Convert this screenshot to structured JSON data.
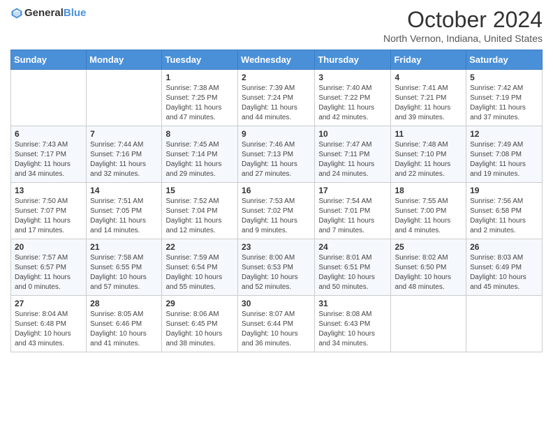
{
  "header": {
    "logo": {
      "text_general": "General",
      "text_blue": "Blue"
    },
    "title": "October 2024",
    "location": "North Vernon, Indiana, United States"
  },
  "days_of_week": [
    "Sunday",
    "Monday",
    "Tuesday",
    "Wednesday",
    "Thursday",
    "Friday",
    "Saturday"
  ],
  "weeks": [
    [
      {
        "day": "",
        "info": ""
      },
      {
        "day": "",
        "info": ""
      },
      {
        "day": "1",
        "info": "Sunrise: 7:38 AM\nSunset: 7:25 PM\nDaylight: 11 hours and 47 minutes."
      },
      {
        "day": "2",
        "info": "Sunrise: 7:39 AM\nSunset: 7:24 PM\nDaylight: 11 hours and 44 minutes."
      },
      {
        "day": "3",
        "info": "Sunrise: 7:40 AM\nSunset: 7:22 PM\nDaylight: 11 hours and 42 minutes."
      },
      {
        "day": "4",
        "info": "Sunrise: 7:41 AM\nSunset: 7:21 PM\nDaylight: 11 hours and 39 minutes."
      },
      {
        "day": "5",
        "info": "Sunrise: 7:42 AM\nSunset: 7:19 PM\nDaylight: 11 hours and 37 minutes."
      }
    ],
    [
      {
        "day": "6",
        "info": "Sunrise: 7:43 AM\nSunset: 7:17 PM\nDaylight: 11 hours and 34 minutes."
      },
      {
        "day": "7",
        "info": "Sunrise: 7:44 AM\nSunset: 7:16 PM\nDaylight: 11 hours and 32 minutes."
      },
      {
        "day": "8",
        "info": "Sunrise: 7:45 AM\nSunset: 7:14 PM\nDaylight: 11 hours and 29 minutes."
      },
      {
        "day": "9",
        "info": "Sunrise: 7:46 AM\nSunset: 7:13 PM\nDaylight: 11 hours and 27 minutes."
      },
      {
        "day": "10",
        "info": "Sunrise: 7:47 AM\nSunset: 7:11 PM\nDaylight: 11 hours and 24 minutes."
      },
      {
        "day": "11",
        "info": "Sunrise: 7:48 AM\nSunset: 7:10 PM\nDaylight: 11 hours and 22 minutes."
      },
      {
        "day": "12",
        "info": "Sunrise: 7:49 AM\nSunset: 7:08 PM\nDaylight: 11 hours and 19 minutes."
      }
    ],
    [
      {
        "day": "13",
        "info": "Sunrise: 7:50 AM\nSunset: 7:07 PM\nDaylight: 11 hours and 17 minutes."
      },
      {
        "day": "14",
        "info": "Sunrise: 7:51 AM\nSunset: 7:05 PM\nDaylight: 11 hours and 14 minutes."
      },
      {
        "day": "15",
        "info": "Sunrise: 7:52 AM\nSunset: 7:04 PM\nDaylight: 11 hours and 12 minutes."
      },
      {
        "day": "16",
        "info": "Sunrise: 7:53 AM\nSunset: 7:02 PM\nDaylight: 11 hours and 9 minutes."
      },
      {
        "day": "17",
        "info": "Sunrise: 7:54 AM\nSunset: 7:01 PM\nDaylight: 11 hours and 7 minutes."
      },
      {
        "day": "18",
        "info": "Sunrise: 7:55 AM\nSunset: 7:00 PM\nDaylight: 11 hours and 4 minutes."
      },
      {
        "day": "19",
        "info": "Sunrise: 7:56 AM\nSunset: 6:58 PM\nDaylight: 11 hours and 2 minutes."
      }
    ],
    [
      {
        "day": "20",
        "info": "Sunrise: 7:57 AM\nSunset: 6:57 PM\nDaylight: 11 hours and 0 minutes."
      },
      {
        "day": "21",
        "info": "Sunrise: 7:58 AM\nSunset: 6:55 PM\nDaylight: 10 hours and 57 minutes."
      },
      {
        "day": "22",
        "info": "Sunrise: 7:59 AM\nSunset: 6:54 PM\nDaylight: 10 hours and 55 minutes."
      },
      {
        "day": "23",
        "info": "Sunrise: 8:00 AM\nSunset: 6:53 PM\nDaylight: 10 hours and 52 minutes."
      },
      {
        "day": "24",
        "info": "Sunrise: 8:01 AM\nSunset: 6:51 PM\nDaylight: 10 hours and 50 minutes."
      },
      {
        "day": "25",
        "info": "Sunrise: 8:02 AM\nSunset: 6:50 PM\nDaylight: 10 hours and 48 minutes."
      },
      {
        "day": "26",
        "info": "Sunrise: 8:03 AM\nSunset: 6:49 PM\nDaylight: 10 hours and 45 minutes."
      }
    ],
    [
      {
        "day": "27",
        "info": "Sunrise: 8:04 AM\nSunset: 6:48 PM\nDaylight: 10 hours and 43 minutes."
      },
      {
        "day": "28",
        "info": "Sunrise: 8:05 AM\nSunset: 6:46 PM\nDaylight: 10 hours and 41 minutes."
      },
      {
        "day": "29",
        "info": "Sunrise: 8:06 AM\nSunset: 6:45 PM\nDaylight: 10 hours and 38 minutes."
      },
      {
        "day": "30",
        "info": "Sunrise: 8:07 AM\nSunset: 6:44 PM\nDaylight: 10 hours and 36 minutes."
      },
      {
        "day": "31",
        "info": "Sunrise: 8:08 AM\nSunset: 6:43 PM\nDaylight: 10 hours and 34 minutes."
      },
      {
        "day": "",
        "info": ""
      },
      {
        "day": "",
        "info": ""
      }
    ]
  ]
}
